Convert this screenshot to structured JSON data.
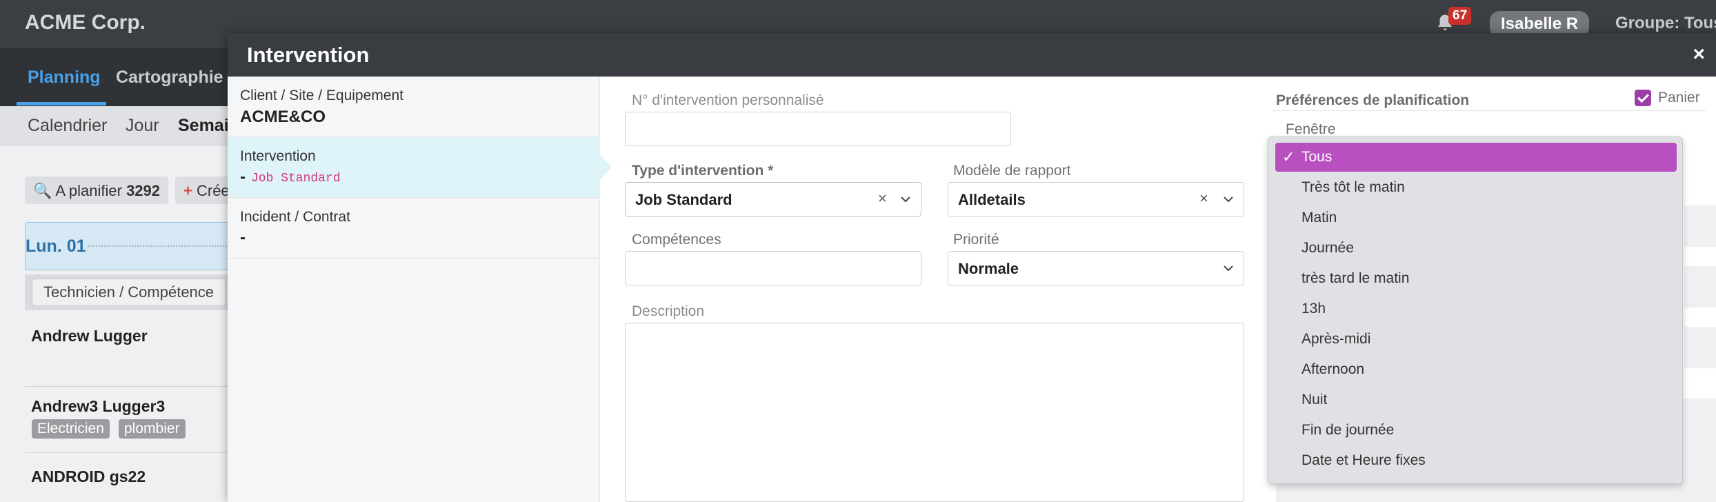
{
  "app": {
    "brand": "ACME Corp.",
    "notifications_count": "67",
    "user": "Isabelle R",
    "group": "Groupe: Tous"
  },
  "nav": {
    "planning": "Planning",
    "cartographie": "Cartographie"
  },
  "views": {
    "calendrier": "Calendrier",
    "jour": "Jour",
    "semaine": "Semaine"
  },
  "planning": {
    "to_plan_label": "A planifier",
    "to_plan_count": "3292",
    "create_label": "Créer",
    "day_label": "Lun. 01",
    "tech_header": "Technicien / Compétence",
    "technicians": [
      {
        "name": "Andrew Lugger"
      },
      {
        "name": "Andrew3 Lugger3",
        "tags": [
          "Electricien",
          "plombier"
        ]
      },
      {
        "name": "ANDROID gs22"
      }
    ]
  },
  "modal": {
    "title": "Intervention",
    "close": "×",
    "left_panel": [
      {
        "title": "Client / Site / Equipement",
        "value": "ACME&CO"
      },
      {
        "title": "Intervention",
        "dash": "-",
        "code": "Job Standard"
      },
      {
        "title": "Incident / Contrat",
        "dash": "-"
      }
    ],
    "form": {
      "custom_number_label": "N° d'intervention personnalisé",
      "custom_number_value": "",
      "type_label": "Type d'intervention *",
      "type_value": "Job Standard",
      "report_model_label": "Modèle de rapport",
      "report_model_value": "Alldetails",
      "skills_label": "Compétences",
      "skills_value": "",
      "priority_label": "Priorité",
      "priority_value": "Normale",
      "description_label": "Description",
      "description_value": ""
    },
    "preferences": {
      "title": "Préférences de planification",
      "basket_label": "Panier",
      "basket_checked": true,
      "window_label": "Fenêtre",
      "window_options": [
        "Tous",
        "Très tôt le matin",
        "Matin",
        "Journée",
        "très tard le matin",
        "13h",
        "Après-midi",
        "Afternoon",
        "Nuit",
        "Fin de journée",
        "Date et Heure fixes"
      ],
      "window_selected": "Tous"
    }
  },
  "colors": {
    "accent": "#4aa0e6",
    "selected_option": "#b950c0",
    "checkbox": "#9b3ea6",
    "code": "#d63384"
  }
}
